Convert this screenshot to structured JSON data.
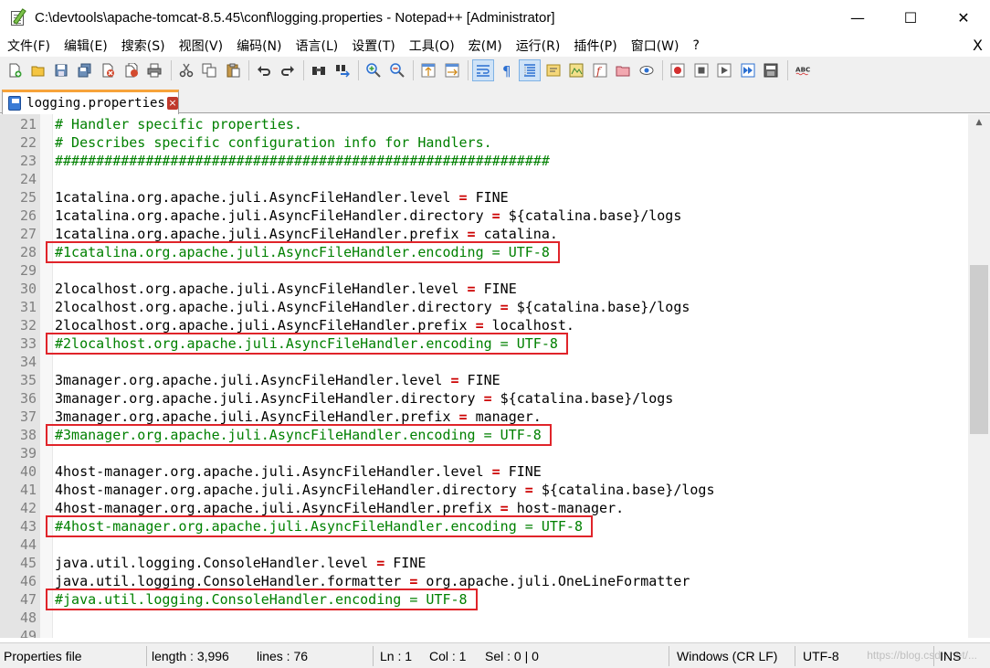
{
  "window": {
    "title": "C:\\devtools\\apache-tomcat-8.5.45\\conf\\logging.properties - Notepad++ [Administrator]",
    "minimize_label": "—",
    "maximize_label": "☐",
    "close_label": "✕"
  },
  "menu": {
    "items": [
      "文件(F)",
      "编辑(E)",
      "搜索(S)",
      "视图(V)",
      "编码(N)",
      "语言(L)",
      "设置(T)",
      "工具(O)",
      "宏(M)",
      "运行(R)",
      "插件(P)",
      "窗口(W)",
      "?"
    ],
    "close_label": "X"
  },
  "toolbar": {
    "buttons": [
      "new-file-icon",
      "open-file-icon",
      "save-icon",
      "save-all-icon",
      "close-icon",
      "close-all-icon",
      "print-icon",
      "cut-icon",
      "copy-icon",
      "paste-icon",
      "undo-icon",
      "redo-icon",
      "find-icon",
      "replace-icon",
      "zoom-in-icon",
      "zoom-out-icon",
      "sync-vertical-icon",
      "sync-horizontal-icon",
      "word-wrap-icon",
      "show-all-chars-icon",
      "indent-guide-icon",
      "user-language-icon",
      "doc-map-icon",
      "function-list-icon",
      "folder-workspace-icon",
      "monitoring-icon",
      "record-macro-icon",
      "stop-macro-icon",
      "play-macro-icon",
      "run-macro-multiple-icon",
      "save-macro-icon",
      "spell-check-icon"
    ]
  },
  "tab": {
    "label": "logging.properties",
    "close_label": "×"
  },
  "editor": {
    "lines": [
      {
        "n": "21",
        "text": "# Handler specific properties.",
        "kind": "comment"
      },
      {
        "n": "22",
        "text": "# Describes specific configuration info for Handlers.",
        "kind": "comment"
      },
      {
        "n": "23",
        "text": "############################################################",
        "kind": "comment"
      },
      {
        "n": "24",
        "text": "",
        "kind": "blank"
      },
      {
        "n": "25",
        "key": "1catalina.org.apache.juli.AsyncFileHandler.level",
        "op": "=",
        "val": "FINE",
        "kind": "prop"
      },
      {
        "n": "26",
        "key": "1catalina.org.apache.juli.AsyncFileHandler.directory",
        "op": "=",
        "val": "${catalina.base}/logs",
        "kind": "prop"
      },
      {
        "n": "27",
        "key": "1catalina.org.apache.juli.AsyncFileHandler.prefix",
        "op": "=",
        "val": "catalina.",
        "kind": "prop"
      },
      {
        "n": "28",
        "text": "#1catalina.org.apache.juli.AsyncFileHandler.encoding = UTF-8",
        "kind": "comment",
        "highlight": true
      },
      {
        "n": "29",
        "text": "",
        "kind": "blank"
      },
      {
        "n": "30",
        "key": "2localhost.org.apache.juli.AsyncFileHandler.level",
        "op": "=",
        "val": "FINE",
        "kind": "prop"
      },
      {
        "n": "31",
        "key": "2localhost.org.apache.juli.AsyncFileHandler.directory",
        "op": "=",
        "val": "${catalina.base}/logs",
        "kind": "prop"
      },
      {
        "n": "32",
        "key": "2localhost.org.apache.juli.AsyncFileHandler.prefix",
        "op": "=",
        "val": "localhost.",
        "kind": "prop"
      },
      {
        "n": "33",
        "text": "#2localhost.org.apache.juli.AsyncFileHandler.encoding = UTF-8",
        "kind": "comment",
        "highlight": true
      },
      {
        "n": "34",
        "text": "",
        "kind": "blank"
      },
      {
        "n": "35",
        "key": "3manager.org.apache.juli.AsyncFileHandler.level",
        "op": "=",
        "val": "FINE",
        "kind": "prop"
      },
      {
        "n": "36",
        "key": "3manager.org.apache.juli.AsyncFileHandler.directory",
        "op": "=",
        "val": "${catalina.base}/logs",
        "kind": "prop"
      },
      {
        "n": "37",
        "key": "3manager.org.apache.juli.AsyncFileHandler.prefix",
        "op": "=",
        "val": "manager.",
        "kind": "prop"
      },
      {
        "n": "38",
        "text": "#3manager.org.apache.juli.AsyncFileHandler.encoding = UTF-8",
        "kind": "comment",
        "highlight": true
      },
      {
        "n": "39",
        "text": "",
        "kind": "blank"
      },
      {
        "n": "40",
        "key": "4host-manager.org.apache.juli.AsyncFileHandler.level",
        "op": "=",
        "val": "FINE",
        "kind": "prop"
      },
      {
        "n": "41",
        "key": "4host-manager.org.apache.juli.AsyncFileHandler.directory",
        "op": "=",
        "val": "${catalina.base}/logs",
        "kind": "prop"
      },
      {
        "n": "42",
        "key": "4host-manager.org.apache.juli.AsyncFileHandler.prefix",
        "op": "=",
        "val": "host-manager.",
        "kind": "prop"
      },
      {
        "n": "43",
        "text": "#4host-manager.org.apache.juli.AsyncFileHandler.encoding = UTF-8",
        "kind": "comment",
        "highlight": true
      },
      {
        "n": "44",
        "text": "",
        "kind": "blank"
      },
      {
        "n": "45",
        "key": "java.util.logging.ConsoleHandler.level",
        "op": "=",
        "val": "FINE",
        "kind": "prop"
      },
      {
        "n": "46",
        "key": "java.util.logging.ConsoleHandler.formatter",
        "op": "=",
        "val": "org.apache.juli.OneLineFormatter",
        "kind": "prop"
      },
      {
        "n": "47",
        "text": "#java.util.logging.ConsoleHandler.encoding = UTF-8",
        "kind": "comment",
        "highlight": true
      },
      {
        "n": "48",
        "text": "",
        "kind": "blank"
      },
      {
        "n": "49",
        "text": "",
        "kind": "blank"
      }
    ]
  },
  "status": {
    "file_type": "Properties file",
    "length": "length : 3,996",
    "lines": "lines : 76",
    "ln": "Ln : 1",
    "col": "Col : 1",
    "sel": "Sel : 0 | 0",
    "eol": "Windows (CR LF)",
    "encoding": "UTF-8",
    "mode": "INS",
    "watermark": "https://blog.csdn.net/..."
  },
  "colors": {
    "comment": "#008000",
    "operator": "#cc0000",
    "highlight_box": "#e0242a",
    "tab_accent": "#f7a33a"
  }
}
